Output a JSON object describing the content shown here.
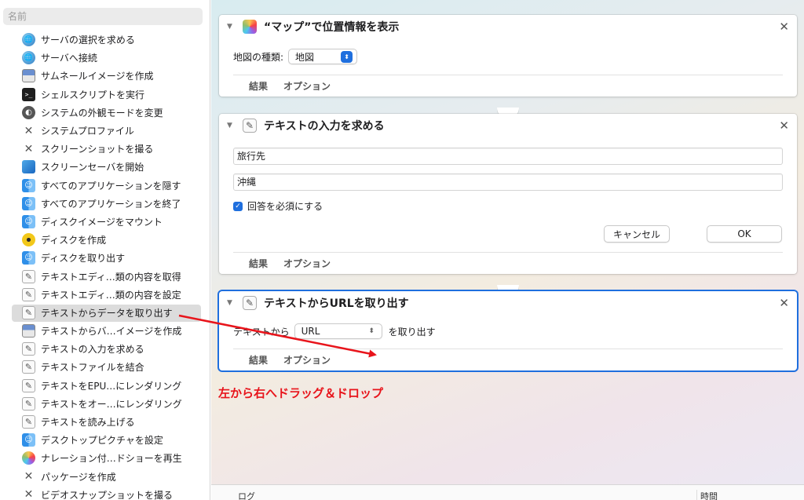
{
  "library": {
    "header": "名前",
    "items": [
      {
        "label": "サーバの選択を求める",
        "icon": "globe-icon",
        "glyph": "🌐"
      },
      {
        "label": "サーバへ接続",
        "icon": "globe-icon",
        "glyph": "🌐"
      },
      {
        "label": "サムネールイメージを作成",
        "icon": "preview-icon",
        "glyph": ""
      },
      {
        "label": "シェルスクリプトを実行",
        "icon": "terminal-icon",
        "glyph": ">_"
      },
      {
        "label": "システムの外観モードを変更",
        "icon": "appearance-icon",
        "glyph": "◐"
      },
      {
        "label": "システムプロファイル",
        "icon": "tools-icon",
        "glyph": "✕"
      },
      {
        "label": "スクリーンショットを撮る",
        "icon": "tools-icon",
        "glyph": "✕"
      },
      {
        "label": "スクリーンセーバを開始",
        "icon": "screensaver-icon",
        "glyph": ""
      },
      {
        "label": "すべてのアプリケーションを隠す",
        "icon": "finder-icon",
        "glyph": "☺"
      },
      {
        "label": "すべてのアプリケーションを終了",
        "icon": "finder-icon",
        "glyph": "☺"
      },
      {
        "label": "ディスクイメージをマウント",
        "icon": "finder-icon",
        "glyph": "☺"
      },
      {
        "label": "ディスクを作成",
        "icon": "radiation-icon",
        "glyph": ""
      },
      {
        "label": "ディスクを取り出す",
        "icon": "finder-icon",
        "glyph": "☺"
      },
      {
        "label": "テキストエディ…類の内容を取得",
        "icon": "textedit-icon",
        "glyph": "✎"
      },
      {
        "label": "テキストエディ…類の内容を設定",
        "icon": "textedit-icon",
        "glyph": "✎"
      },
      {
        "label": "テキストからデータを取り出す",
        "icon": "textedit-icon",
        "glyph": "✎",
        "selected": true
      },
      {
        "label": "テキストからバ…イメージを作成",
        "icon": "preview-icon",
        "glyph": ""
      },
      {
        "label": "テキストの入力を求める",
        "icon": "textedit-icon",
        "glyph": "✎"
      },
      {
        "label": "テキストファイルを結合",
        "icon": "textedit-icon",
        "glyph": "✎"
      },
      {
        "label": "テキストをEPU…にレンダリング",
        "icon": "textedit-icon",
        "glyph": "✎"
      },
      {
        "label": "テキストをオー…にレンダリング",
        "icon": "textedit-icon",
        "glyph": "✎"
      },
      {
        "label": "テキストを読み上げる",
        "icon": "textedit-icon",
        "glyph": "✎"
      },
      {
        "label": "デスクトップピクチャを設定",
        "icon": "finder-icon",
        "glyph": "☺"
      },
      {
        "label": "ナレーション付…ドショーを再生",
        "icon": "photos-icon",
        "glyph": ""
      },
      {
        "label": "パッケージを作成",
        "icon": "tools-icon",
        "glyph": "✕"
      },
      {
        "label": "ビデオスナップショットを撮る",
        "icon": "tools-icon",
        "glyph": "✕"
      }
    ]
  },
  "cards": {
    "map": {
      "title": "“マップ”で位置情報を表示",
      "map_type_label": "地図の種類:",
      "map_type_value": "地図",
      "tab_results": "結果",
      "tab_options": "オプション"
    },
    "ask_text": {
      "title": "テキストの入力を求める",
      "question_value": "旅行先",
      "default_value": "沖縄",
      "require_label": "回答を必須にする",
      "cancel_label": "キャンセル",
      "ok_label": "OK",
      "tab_results": "結果",
      "tab_options": "オプション"
    },
    "extract_url": {
      "title": "テキストからURLを取り出す",
      "from_label": "テキストから",
      "type_value": "URL",
      "suffix_label": "を取り出す",
      "tab_results": "結果",
      "tab_options": "オプション"
    }
  },
  "logbar": {
    "log_label": "ログ",
    "time_label": "時間"
  },
  "annotation": {
    "text": "左から右へドラッグ＆ドロップ",
    "color": "#e8141b"
  },
  "colors": {
    "accent": "#1f6fde"
  }
}
